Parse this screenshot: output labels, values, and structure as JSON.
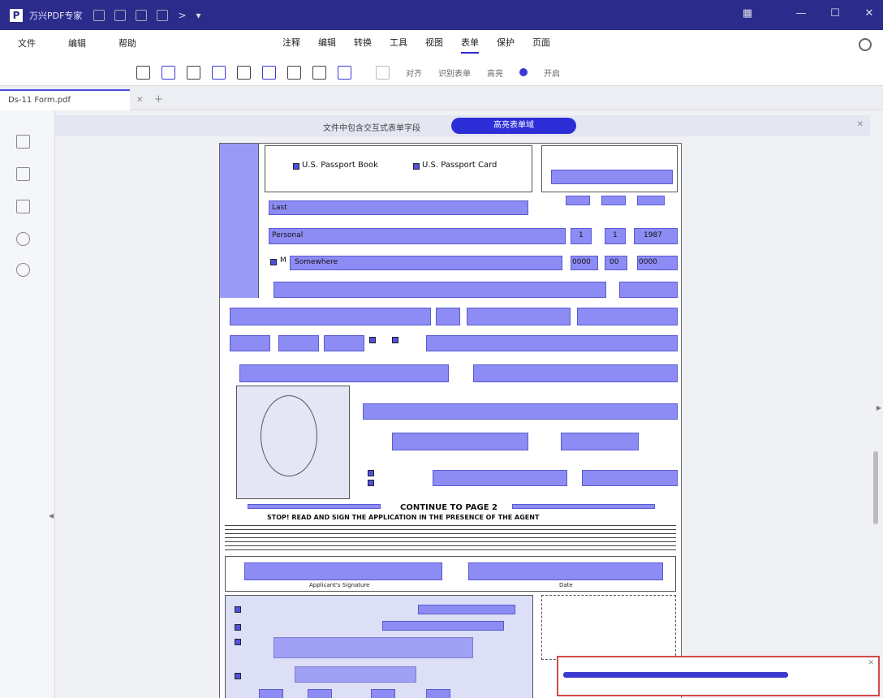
{
  "titlebar": {
    "app_name": "万兴PDF专家",
    "icons": [
      "open-icon",
      "save-icon",
      "print-icon",
      "undo-icon",
      "redo-icon",
      "dropdown-icon"
    ],
    "window_controls": [
      "grid-icon",
      "minimize-icon",
      "maximize-icon",
      "close-icon"
    ]
  },
  "menubar": {
    "left_items": [
      "文件",
      "编辑",
      "帮助"
    ],
    "center_items": [
      "注释",
      "编辑",
      "转换",
      "工具",
      "视图",
      "表单",
      "保护",
      "页面"
    ],
    "active_item": "表单"
  },
  "toolbar": {
    "tools": [
      "text-field-icon",
      "checkbox-icon",
      "radio-button-icon",
      "list-box-icon",
      "combo-box-icon",
      "button-icon",
      "image-field-icon",
      "signature-field-icon",
      "pin-icon"
    ],
    "align_label": "对齐",
    "recognize_label": "识别表单",
    "highlight_label": "高亮",
    "highlight_state": "开启"
  },
  "tabs": {
    "doc_tab": "Ds-11 Form.pdf",
    "close": "✕",
    "new_tab": "+"
  },
  "sidebar_icons": [
    "thumbnail-icon",
    "bookmark-icon",
    "attachment-icon",
    "comment-icon",
    "search-icon"
  ],
  "notification": {
    "text": "文件中包含交互式表单字段",
    "button": "高亮表单域",
    "close": "✕"
  },
  "form": {
    "passport_book": "U.S. Passport Book",
    "passport_card": "U.S. Passport Card",
    "last_name_value": "Last",
    "first_name_value": "Personal",
    "sex_value": "M",
    "birthplace_value": "Somewhere",
    "dob_m": "1",
    "dob_d": "1",
    "dob_y": "1987",
    "ssn1": "0000",
    "ssn2": "00",
    "ssn3": "0000",
    "continue_text": "CONTINUE TO PAGE 2",
    "sign_text": "STOP! READ AND SIGN THE APPLICATION IN THE PRESENCE OF THE AGENT",
    "signature_label": "Applicant's Signature",
    "date_label": "Date"
  },
  "popup": {
    "close": "✕",
    "progress": 0.73
  }
}
